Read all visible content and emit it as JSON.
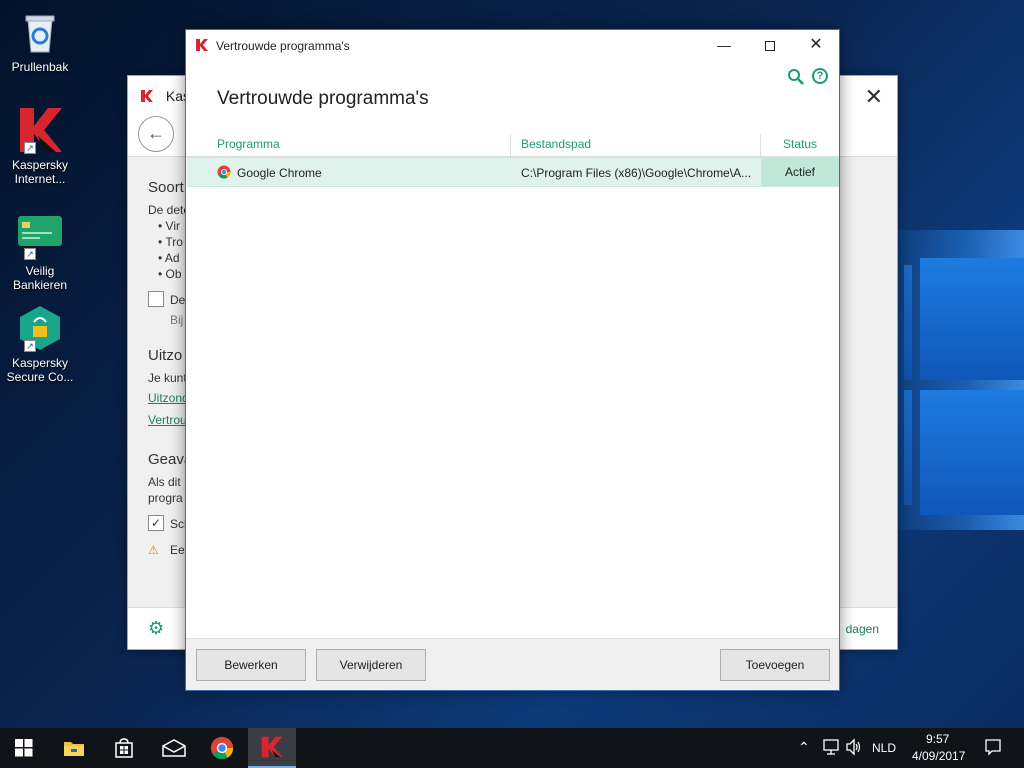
{
  "desktop": {
    "icons": [
      {
        "label": "Prullenbak"
      },
      {
        "label": "Kaspersky Internet..."
      },
      {
        "label": "Veilig Bankieren"
      },
      {
        "label": "Kaspersky Secure Co..."
      }
    ]
  },
  "background_window": {
    "title": "Kas",
    "sections": {
      "s1_heading": "Soort",
      "s1_text": "De dete",
      "s1_items": [
        "Vir",
        "Tro",
        "Ad",
        "Ob"
      ],
      "s1_checkbox_label": "De",
      "s1_sub": "Bij",
      "s2_heading": "Uitzo",
      "s2_text": "Je kunt",
      "s2_link1": "Uitzond",
      "s2_link2": "Vertrou",
      "s3_heading": "Geava",
      "s3_text1": "Als dit",
      "s3_text2": "progra",
      "s3_checkbox_label": "Sch",
      "s3_warning": "Een"
    },
    "footer_link": "dagen"
  },
  "dialog": {
    "title": "Vertrouwde programma's",
    "heading": "Vertrouwde programma's",
    "columns": {
      "program": "Programma",
      "path": "Bestandspad",
      "status": "Status"
    },
    "rows": [
      {
        "program": "Google Chrome",
        "path": "C:\\Program Files (x86)\\Google\\Chrome\\A...",
        "status": "Actief"
      }
    ],
    "buttons": {
      "edit": "Bewerken",
      "remove": "Verwijderen",
      "add": "Toevoegen"
    }
  },
  "taskbar": {
    "language": "NLD",
    "time": "9:57",
    "date": "4/09/2017"
  },
  "colors": {
    "accent": "#1a9a7a",
    "row_selected": "#dff3ec",
    "kaspersky_red": "#d8262e"
  }
}
